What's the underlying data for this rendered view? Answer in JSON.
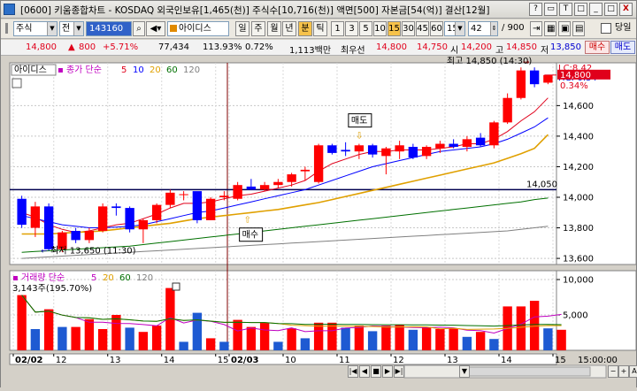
{
  "window": {
    "title": "[0600] 키움종합차트 - KOSDAQ 외국인보유[1,465(천)] 주식수[10,716(천)] 액면[500] 자본금[54(억)] 결산[12월]",
    "buttons": [
      "?",
      "▭",
      "T",
      "□",
      "_",
      "□",
      "X"
    ]
  },
  "toolbar": {
    "market": "주식",
    "mode": "전",
    "code": "143160",
    "stock_name": "아이디스",
    "periods": [
      "일",
      "주",
      "월",
      "년"
    ],
    "min_label": "분",
    "tick_label": "틱",
    "intervals": [
      "1",
      "3",
      "5",
      "10",
      "15",
      "30",
      "45",
      "60",
      "15"
    ],
    "selected_interval": "15",
    "count": "42",
    "count_total": "/ 900",
    "single_label": "당일"
  },
  "info": {
    "price": "14,800",
    "change": "800",
    "rate": "+5.71%",
    "volume": "77,434",
    "vol_ratio": "113.93%",
    "turnover": "0.72%",
    "amount": "1,113백만",
    "best_label": "최우선",
    "ask": "14,800",
    "bid": "14,750",
    "open_label": "시",
    "open": "14,200",
    "high_label": "고",
    "high": "14,850",
    "low_label": "저",
    "low": "13,850",
    "buy_btn": "매수",
    "sell_btn": "매도"
  },
  "price_pane": {
    "name": "아이디스",
    "ma_label": "종가 단순",
    "ma_periods": [
      "5",
      "10",
      "20",
      "60",
      "120"
    ],
    "ma_colors": [
      "#e0001b",
      "#0000ff",
      "#e0a000",
      "#007000",
      "#808080"
    ],
    "lc": "LC:8.42",
    "hc": "HC:-0.34",
    "current": "14,800",
    "current_pct": "0.34%",
    "high_annot": "최고 14,850 (14:30)",
    "low_annot": "최저 13,650 (11:30)",
    "sell_tag": "매도",
    "buy_tag": "매수",
    "hline_label": "14,050",
    "y_ticks": [
      "14,600",
      "14,400",
      "14,200",
      "14,000",
      "13,800",
      "13,600"
    ]
  },
  "volume_pane": {
    "label": "거래량 단순",
    "ma_periods": [
      "5",
      "20",
      "60",
      "120"
    ],
    "current": "3,143주(195.70%)",
    "y_ticks": [
      "10,000",
      "5,000"
    ]
  },
  "x_axis": {
    "labels": [
      "02/02",
      "12",
      "13",
      "14",
      "15",
      "02/03",
      "10",
      "11",
      "12",
      "13",
      "14",
      "15"
    ],
    "time_end": "15:00:00"
  },
  "nav": {
    "buttons": [
      "|◀",
      "◀",
      "■",
      "▶",
      "▶|",
      "▼",
      "−",
      "+",
      "A"
    ]
  },
  "chart_data": {
    "type": "candlestick",
    "interval": "15min",
    "ylim": [
      13560,
      14880
    ],
    "candles": [
      {
        "o": 13990,
        "h": 14010,
        "l": 13800,
        "c": 13820
      },
      {
        "o": 13800,
        "h": 13970,
        "l": 13740,
        "c": 13940
      },
      {
        "o": 13940,
        "h": 13960,
        "l": 13650,
        "c": 13660
      },
      {
        "o": 13660,
        "h": 13780,
        "l": 13640,
        "c": 13770
      },
      {
        "o": 13780,
        "h": 13800,
        "l": 13700,
        "c": 13720
      },
      {
        "o": 13720,
        "h": 13800,
        "l": 13700,
        "c": 13780
      },
      {
        "o": 13780,
        "h": 13960,
        "l": 13770,
        "c": 13940
      },
      {
        "o": 13940,
        "h": 13960,
        "l": 13880,
        "c": 13930
      },
      {
        "o": 13930,
        "h": 13940,
        "l": 13770,
        "c": 13790
      },
      {
        "o": 13790,
        "h": 13860,
        "l": 13700,
        "c": 13850
      },
      {
        "o": 13850,
        "h": 13960,
        "l": 13830,
        "c": 13950
      },
      {
        "o": 13950,
        "h": 14050,
        "l": 13930,
        "c": 14030
      },
      {
        "o": 14020,
        "h": 14040,
        "l": 13980,
        "c": 14020
      },
      {
        "o": 14040,
        "h": 14030,
        "l": 13830,
        "c": 13850
      },
      {
        "o": 13850,
        "h": 14000,
        "l": 13850,
        "c": 13990
      },
      {
        "o": 14000,
        "h": 14040,
        "l": 13980,
        "c": 14010
      },
      {
        "o": 13990,
        "h": 14100,
        "l": 13980,
        "c": 14080
      },
      {
        "o": 14070,
        "h": 14120,
        "l": 14050,
        "c": 14050
      },
      {
        "o": 14050,
        "h": 14100,
        "l": 14040,
        "c": 14080
      },
      {
        "o": 14080,
        "h": 14120,
        "l": 14060,
        "c": 14100
      },
      {
        "o": 14100,
        "h": 14160,
        "l": 14070,
        "c": 14150
      },
      {
        "o": 14170,
        "h": 14200,
        "l": 14110,
        "c": 14180
      },
      {
        "o": 14100,
        "h": 14350,
        "l": 14090,
        "c": 14340
      },
      {
        "o": 14340,
        "h": 14350,
        "l": 14280,
        "c": 14290
      },
      {
        "o": 14310,
        "h": 14360,
        "l": 14270,
        "c": 14300
      },
      {
        "o": 14300,
        "h": 14350,
        "l": 14250,
        "c": 14340
      },
      {
        "o": 14340,
        "h": 14350,
        "l": 14260,
        "c": 14280
      },
      {
        "o": 14270,
        "h": 14330,
        "l": 14150,
        "c": 14320
      },
      {
        "o": 14300,
        "h": 14370,
        "l": 14250,
        "c": 14340
      },
      {
        "o": 14330,
        "h": 14350,
        "l": 14250,
        "c": 14260
      },
      {
        "o": 14270,
        "h": 14340,
        "l": 14250,
        "c": 14330
      },
      {
        "o": 14320,
        "h": 14370,
        "l": 14290,
        "c": 14350
      },
      {
        "o": 14350,
        "h": 14380,
        "l": 14320,
        "c": 14330
      },
      {
        "o": 14330,
        "h": 14400,
        "l": 14300,
        "c": 14380
      },
      {
        "o": 14390,
        "h": 14420,
        "l": 14330,
        "c": 14340
      },
      {
        "o": 14340,
        "h": 14500,
        "l": 14320,
        "c": 14490
      },
      {
        "o": 14490,
        "h": 14680,
        "l": 14480,
        "c": 14650
      },
      {
        "o": 14650,
        "h": 14850,
        "l": 14640,
        "c": 14830
      },
      {
        "o": 14830,
        "h": 14850,
        "l": 14720,
        "c": 14740
      },
      {
        "o": 14750,
        "h": 14800,
        "l": 14740,
        "c": 14800
      }
    ],
    "ma": [
      {
        "name": "5",
        "values": [
          13900,
          13870,
          13820,
          13790,
          13770,
          13780,
          13800,
          13820,
          13830,
          13860,
          13890,
          13930,
          13960,
          13960,
          13970,
          13990,
          14010,
          14020,
          14040,
          14060,
          14080,
          14110,
          14170,
          14220,
          14250,
          14280,
          14300,
          14300,
          14310,
          14310,
          14310,
          14320,
          14330,
          14350,
          14350,
          14380,
          14430,
          14500,
          14560,
          14650
        ]
      },
      {
        "name": "10",
        "values": [
          13880,
          13860,
          13840,
          13820,
          13810,
          13800,
          13800,
          13805,
          13810,
          13820,
          13840,
          13860,
          13880,
          13900,
          13910,
          13930,
          13950,
          13970,
          13990,
          14010,
          14030,
          14050,
          14080,
          14110,
          14140,
          14170,
          14200,
          14220,
          14240,
          14260,
          14280,
          14300,
          14310,
          14320,
          14330,
          14350,
          14380,
          14420,
          14460,
          14520
        ]
      },
      {
        "name": "20",
        "values": [
          13760,
          13760,
          13760,
          13765,
          13770,
          13775,
          13780,
          13790,
          13800,
          13810,
          13820,
          13830,
          13845,
          13860,
          13870,
          13880,
          13890,
          13900,
          13910,
          13920,
          13935,
          13950,
          13965,
          13985,
          14005,
          14025,
          14045,
          14065,
          14085,
          14105,
          14125,
          14145,
          14165,
          14185,
          14205,
          14225,
          14255,
          14285,
          14320,
          14410
        ]
      },
      {
        "name": "60",
        "values": [
          13640,
          13645,
          13650,
          13655,
          13660,
          13665,
          13670,
          13675,
          13680,
          13690,
          13700,
          13710,
          13720,
          13730,
          13740,
          13750,
          13760,
          13770,
          13780,
          13790,
          13800,
          13810,
          13820,
          13830,
          13840,
          13850,
          13860,
          13870,
          13880,
          13890,
          13900,
          13910,
          13920,
          13930,
          13940,
          13950,
          13960,
          13970,
          13985,
          13995
        ]
      },
      {
        "name": "120",
        "values": [
          13600,
          13605,
          13610,
          13615,
          13620,
          13625,
          13630,
          13635,
          13640,
          13645,
          13650,
          13655,
          13660,
          13665,
          13670,
          13675,
          13680,
          13685,
          13690,
          13695,
          13700,
          13705,
          13710,
          13715,
          13720,
          13725,
          13730,
          13735,
          13740,
          13745,
          13750,
          13755,
          13760,
          13765,
          13770,
          13775,
          13780,
          13790,
          13800,
          13810
        ]
      }
    ],
    "volume": [
      7800,
      3000,
      5800,
      3300,
      3300,
      4400,
      3000,
      5000,
      3200,
      2600,
      3500,
      8800,
      1200,
      5300,
      1700,
      1200,
      4300,
      3300,
      3900,
      1200,
      3100,
      1700,
      3900,
      3900,
      3200,
      3500,
      2700,
      3500,
      3600,
      2900,
      3300,
      3000,
      3100,
      1900,
      2600,
      1600,
      6200,
      6200,
      7000,
      3100,
      2900
    ],
    "volume_up": [
      true,
      false,
      true,
      false,
      true,
      true,
      true,
      true,
      false,
      true,
      true,
      true,
      false,
      false,
      true,
      false,
      true,
      true,
      true,
      false,
      true,
      false,
      true,
      true,
      false,
      true,
      false,
      true,
      true,
      false,
      true,
      true,
      true,
      false,
      true,
      false,
      true,
      true,
      true,
      false,
      true
    ],
    "volume_ylim": [
      0,
      10500
    ]
  }
}
